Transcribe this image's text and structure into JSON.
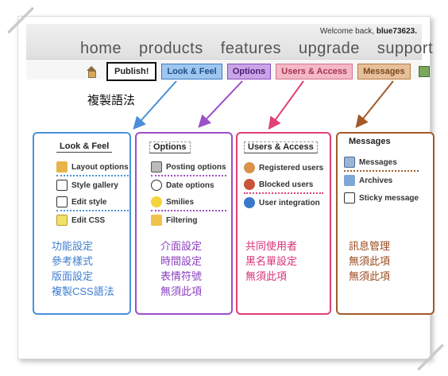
{
  "header": {
    "welcome_prefix": "Welcome back,",
    "welcome_user": "blue73623.",
    "nav": [
      "home",
      "products",
      "features",
      "upgrade",
      "support"
    ]
  },
  "tabs": {
    "publish": "Publish!",
    "look": "Look & Feel",
    "options": "Options",
    "users": "Users & Access",
    "messages": "Messages"
  },
  "syntax_label": "複製語法",
  "panels": {
    "look": {
      "title": "Look & Feel",
      "items": [
        "Layout options",
        "Style gallery",
        "Edit style",
        "Edit CSS"
      ],
      "notes": [
        "功能設定",
        "參考樣式",
        "版面設定",
        "複製CSS語法"
      ]
    },
    "options": {
      "title": "Options",
      "items": [
        "Posting options",
        "Date options",
        "Smilies",
        "Filtering"
      ],
      "notes": [
        "介面設定",
        "時間設定",
        "表情符號",
        "無須此項"
      ]
    },
    "users": {
      "title": "Users & Access",
      "items": [
        "Registered users",
        "Blocked users",
        "User integration"
      ],
      "notes": [
        "共同使用者",
        "黑名單設定",
        "無須此項"
      ]
    },
    "messages": {
      "title": "Messages",
      "items": [
        "Messages",
        "Archives",
        "Sticky message"
      ],
      "notes": [
        "訊息管理",
        "無須此項",
        "無須此項"
      ]
    }
  },
  "colors": {
    "look": "#4a90d9",
    "options": "#9b4fc9",
    "users": "#e0407a",
    "messages": "#a25a2a"
  },
  "icons": [
    "home-icon",
    "help-icon",
    "layout-icon",
    "gallery-icon",
    "edit-style-icon",
    "edit-css-icon",
    "tools-icon",
    "clock-icon",
    "smiley-icon",
    "filter-icon",
    "users-icon",
    "blocked-icon",
    "globe-icon",
    "messages-icon",
    "folder-icon",
    "sticky-icon"
  ]
}
